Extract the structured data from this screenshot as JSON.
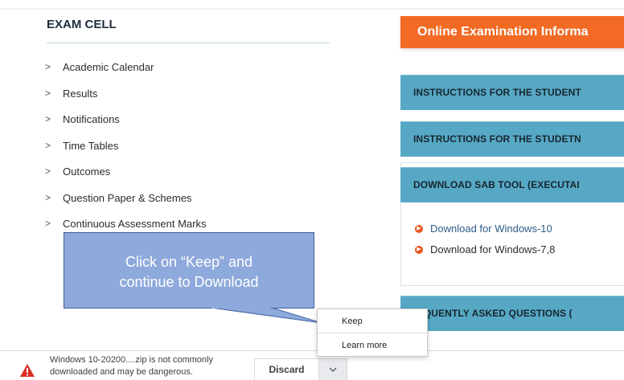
{
  "sidebar": {
    "title": "EXAM CELL",
    "items": [
      {
        "label": "Academic Calendar"
      },
      {
        "label": "Results"
      },
      {
        "label": "Notifications"
      },
      {
        "label": "Time Tables"
      },
      {
        "label": "Outcomes"
      },
      {
        "label": "Question Paper & Schemes"
      },
      {
        "label": "Continuous Assessment Marks"
      }
    ],
    "chevron": ">"
  },
  "main": {
    "banner": "Online Examination Informa",
    "bars": [
      "INSTRUCTIONS FOR THE STUDENT",
      "INSTRUCTIONS FOR THE STUDETN",
      "DOWNLOAD SAB TOOL (EXECUTAI"
    ],
    "downloads": [
      {
        "label": "Download for Windows-10",
        "color": "#2e5c8a"
      },
      {
        "label": "Download for Windows-7,8",
        "color": "#2c2c2c"
      }
    ],
    "faq_bar": "REQUENTLY ASKED QUESTIONS ("
  },
  "callout": {
    "line1": "Click on “Keep” and",
    "line2": "continue to Download"
  },
  "popup": {
    "keep": "Keep",
    "learn_more": "Learn more"
  },
  "shelf": {
    "line1": "Windows 10-20200....zip is not commonly",
    "line2": "downloaded and may be dangerous.",
    "discard": "Discard"
  },
  "colors": {
    "accent_orange": "#f26a24",
    "bar_blue": "#56a8c5",
    "callout_fill": "#8ea9db",
    "warning_red": "#d93025"
  },
  "icons": {
    "warning": "warning-triangle-icon",
    "chevron": "chevron-down-icon",
    "bullet": "circle-arrow-icon"
  }
}
